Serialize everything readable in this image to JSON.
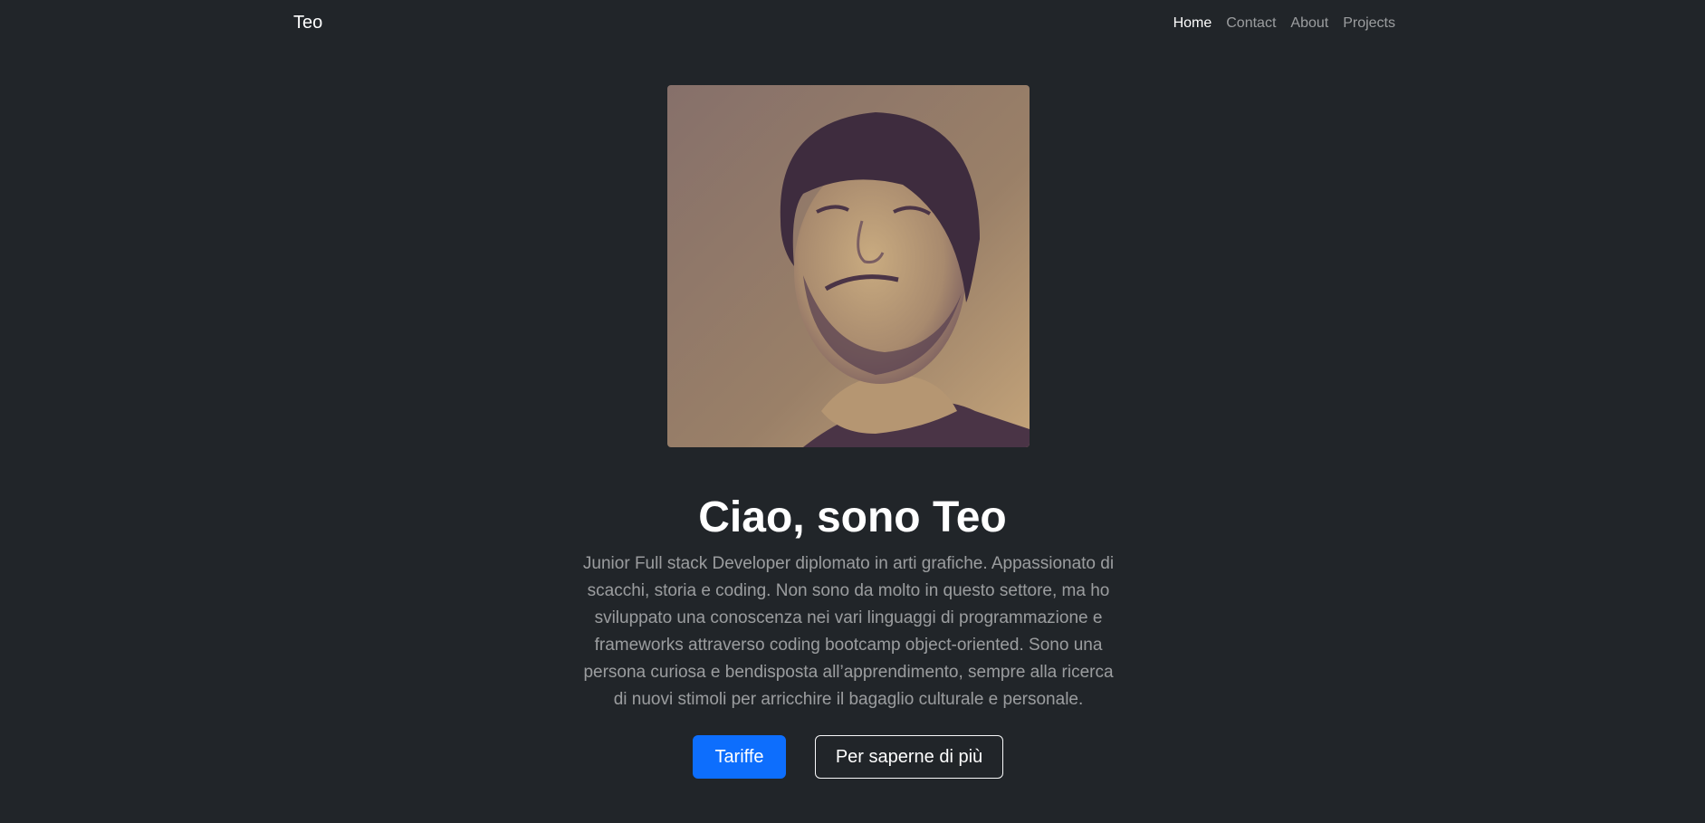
{
  "navbar": {
    "brand": "Teo",
    "links": [
      {
        "label": "Home",
        "active": true
      },
      {
        "label": "Contact",
        "active": false
      },
      {
        "label": "About",
        "active": false
      },
      {
        "label": "Projects",
        "active": false
      }
    ]
  },
  "hero": {
    "title": "Ciao, sono Teo",
    "description": "Junior Full stack Developer diplomato in arti grafiche. Appassionato di scacchi, storia e coding. Non sono da molto in questo settore, ma ho sviluppato una conoscenza nei vari linguaggi di programmazione e frameworks attraverso coding bootcamp object-oriented. Sono una persona curiosa e bendisposta all’apprendimento, sempre alla ricerca di nuovi stimoli per arricchire il bagaglio culturale e personale.",
    "primary_button": "Tariffe",
    "secondary_button": "Per saperne di più"
  },
  "colors": {
    "background": "#212529",
    "primary": "#0d6efd",
    "muted_text": "rgba(255,255,255,0.55)"
  }
}
